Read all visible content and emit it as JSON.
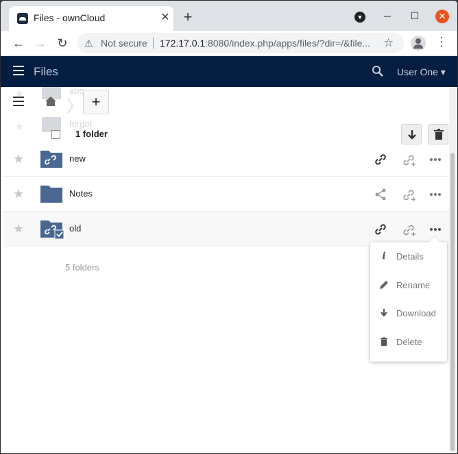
{
  "browser": {
    "tab_title": "Files - ownCloud",
    "tab_close": "✕",
    "new_tab": "+",
    "security_label": "Not secure",
    "url_host": "172.17.0.1",
    "url_rest": ":8080/index.php/apps/files/?dir=/&file..."
  },
  "header": {
    "app_title": "Files",
    "user_name": "User One"
  },
  "ghost_rows": [
    "abc",
    "forgot"
  ],
  "breadcrumb": {
    "add_label": "+"
  },
  "selection": {
    "count_label": "1 folder"
  },
  "files": [
    {
      "name": "new",
      "shared_link": true,
      "selected": false
    },
    {
      "name": "Notes",
      "shared_link": false,
      "selected": false
    },
    {
      "name": "old",
      "shared_link": true,
      "selected": true
    }
  ],
  "summary": "5 folders",
  "context_menu": {
    "items": [
      {
        "label": "Details",
        "icon": "info-icon"
      },
      {
        "label": "Rename",
        "icon": "pencil-icon"
      },
      {
        "label": "Download",
        "icon": "download-icon"
      },
      {
        "label": "Delete",
        "icon": "trash-icon"
      }
    ]
  },
  "colors": {
    "header_bg": "#041e42",
    "folder": "#4a6791",
    "close_button": "#e95420"
  }
}
